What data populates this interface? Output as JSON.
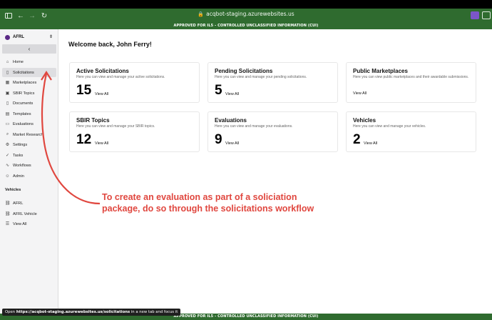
{
  "browser": {
    "url": "acqbot-staging.azurewebsites.us",
    "banner_top": "APPROVED FOR IL5 - CONTROLLED UNCLASSIFIED INFORMATION (CUI)",
    "banner_bottom": "APPROVED FOR IL5 - CONTROLLED UNCLASSIFIED INFORMATION (CUI)",
    "status_prefix": "Open ",
    "status_link": "https://acqbot-staging.azurewebsites.us/solicitations",
    "status_suffix": " in a new tab and focus it"
  },
  "sidebar": {
    "org_name": "AFRL",
    "collapse_icon": "chevron-left-icon",
    "items": [
      {
        "label": "Home",
        "icon": "⌂"
      },
      {
        "label": "Solicitations",
        "icon": "▯"
      },
      {
        "label": "Marketplaces",
        "icon": "▦"
      },
      {
        "label": "SBIR Topics",
        "icon": "▣"
      },
      {
        "label": "Documents",
        "icon": "▯"
      },
      {
        "label": "Templates",
        "icon": "▤"
      },
      {
        "label": "Evaluations",
        "icon": "▭"
      },
      {
        "label": "Market Research",
        "icon": "⌕"
      },
      {
        "label": "Settings",
        "icon": "⚙"
      },
      {
        "label": "Tasks",
        "icon": "✓"
      },
      {
        "label": "Workflows",
        "icon": "∿"
      },
      {
        "label": "Admin",
        "icon": "☺"
      }
    ],
    "vehicles_label": "Vehicles",
    "vehicles": [
      {
        "label": "AFRL",
        "icon": "⛓"
      },
      {
        "label": "AFRL Vehicle",
        "icon": "⛓"
      },
      {
        "label": "View All",
        "icon": "☰"
      }
    ]
  },
  "main": {
    "welcome": "Welcome back, John Ferry!",
    "cards": [
      {
        "title": "Active Solicitations",
        "desc": "Here you can view and manage your active solicitations.",
        "count": "15",
        "view": "View All"
      },
      {
        "title": "Pending Solicitations",
        "desc": "Here you can view and manage your pending solicitations.",
        "count": "5",
        "view": "View All"
      },
      {
        "title": "Public Marketplaces",
        "desc": "Here you can view public marketplaces and their awardable submissions.",
        "count": "",
        "view": "View All"
      },
      {
        "title": "SBIR Topics",
        "desc": "Here you can view and manage your SBIR topics.",
        "count": "12",
        "view": "View All"
      },
      {
        "title": "Evaluations",
        "desc": "Here you can view and manage your evaluations.",
        "count": "9",
        "view": "View All"
      },
      {
        "title": "Vehicles",
        "desc": "Here you can view and manage your vehicles.",
        "count": "2",
        "view": "View All"
      }
    ]
  },
  "annotation": {
    "line1": "To create an evaluation as part of a soliciation",
    "line2": "package, do so through the solicitations workflow",
    "color": "#e0473f"
  }
}
